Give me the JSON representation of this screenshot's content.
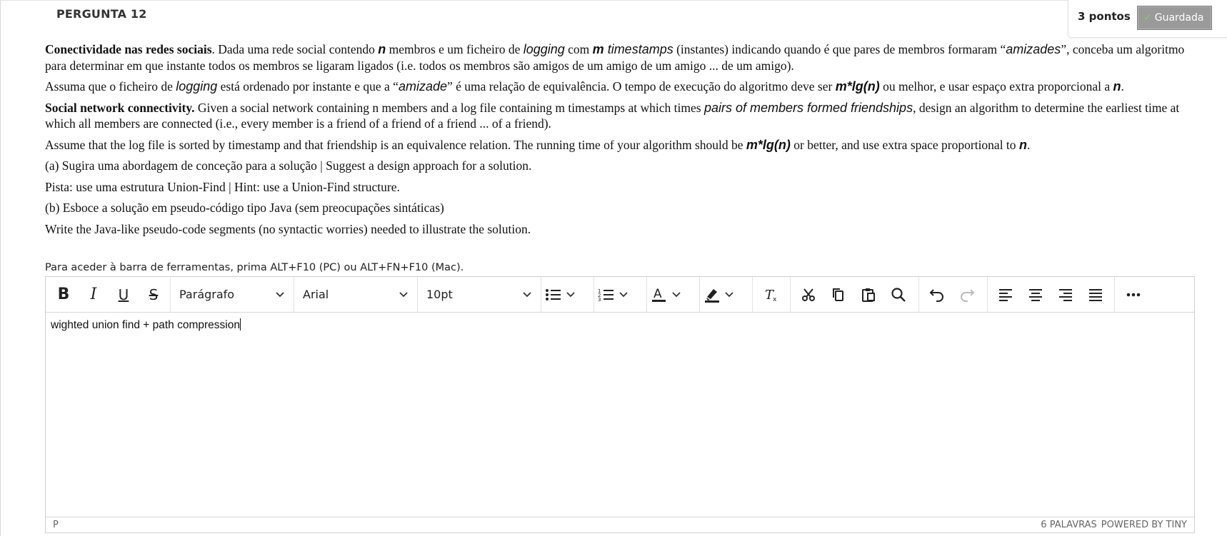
{
  "question": {
    "title": "PERGUNTA 12",
    "points": "3 pontos",
    "status_label": "Guardada"
  },
  "text": {
    "p1_b": "Conectividade nas redes sociais",
    "p1_a": ". Dada uma rede social contendo ",
    "p1_n": "n",
    "p1_c": " membros e um ficheiro de ",
    "p1_logging": "logging",
    "p1_d": " com ",
    "p1_m": "m",
    "p1_ts": " timestamps",
    "p1_e": " (instantes) indicando quando é que pares de membros formaram “",
    "p1_amizades": "amizades",
    "p1_f": "”, conceba um algoritmo para determinar em que instante todos os membros se ligaram ligados (i.e. todos os membros são amigos de um amigo de um amigo ... de um amigo).",
    "p2_a": "Assuma que o ficheiro de ",
    "p2_logging": "logging",
    "p2_b": " está ordenado por instante e que a “",
    "p2_amizade": "amizade",
    "p2_c": "” é uma relação de equivalência.  O tempo de execução do algoritmo deve ser ",
    "p2_mlg": "m*lg(n)",
    "p2_d": " ou melhor, e usar espaço extra proporcional a ",
    "p2_n": "n",
    "p2_e": ".",
    "p3_b": "Social network connectivity.",
    "p3_a": " Given a social network containing n members and a log file containing m timestamps at which times ",
    "p3_pairs": "pairs of members formed friendships",
    "p3_c": ", design an algorithm to determine the earliest time at which all members are connected (i.e., every member is a friend of a friend of a friend ... of a friend).",
    "p4_a": "Assume that the log file is sorted by timestamp and that friendship is an equivalence relation. The running time of your algorithm should be ",
    "p4_mlg": "m*lg(n)",
    "p4_b": " or better, and use extra space proportional to ",
    "p4_n": "n",
    "p4_c": ".",
    "p5": "(a) Sugira uma abordagem de conceção para a solução | Suggest a design approach for a solution.",
    "p6": "Pista: use uma estrutura Union-Find | Hint: use a Union-Find structure.",
    "p7": "(b) Esboce a solução em pseudo-código tipo Java (sem preocupações sintáticas)",
    "p8": "Write the Java-like pseudo-code segments (no syntactic worries) needed to illustrate the solution."
  },
  "editor": {
    "hint": "Para aceder à barra de ferramentas, prima ALT+F10 (PC) ou ALT+FN+F10 (Mac).",
    "block_format": "Parágrafo",
    "font_family": "Arial",
    "font_size": "10pt",
    "content": "wighted union find + path compression",
    "status_path": "P",
    "word_count": "6 PALAVRAS",
    "powered_by": "POWERED BY TINY",
    "icons": [
      "bold-icon",
      "italic-icon",
      "underline-icon",
      "strikethrough-icon",
      "bullet-list-icon",
      "numbered-list-icon",
      "text-color-icon",
      "highlight-icon",
      "clear-format-icon",
      "cut-icon",
      "copy-icon",
      "paste-icon",
      "search-icon",
      "undo-icon",
      "redo-icon",
      "align-left-icon",
      "align-center-icon",
      "align-right-icon",
      "justify-icon",
      "more-icon"
    ]
  },
  "colors": {
    "saved_bg": "#9a9a9a",
    "saved_check": "#6ddc4a"
  }
}
